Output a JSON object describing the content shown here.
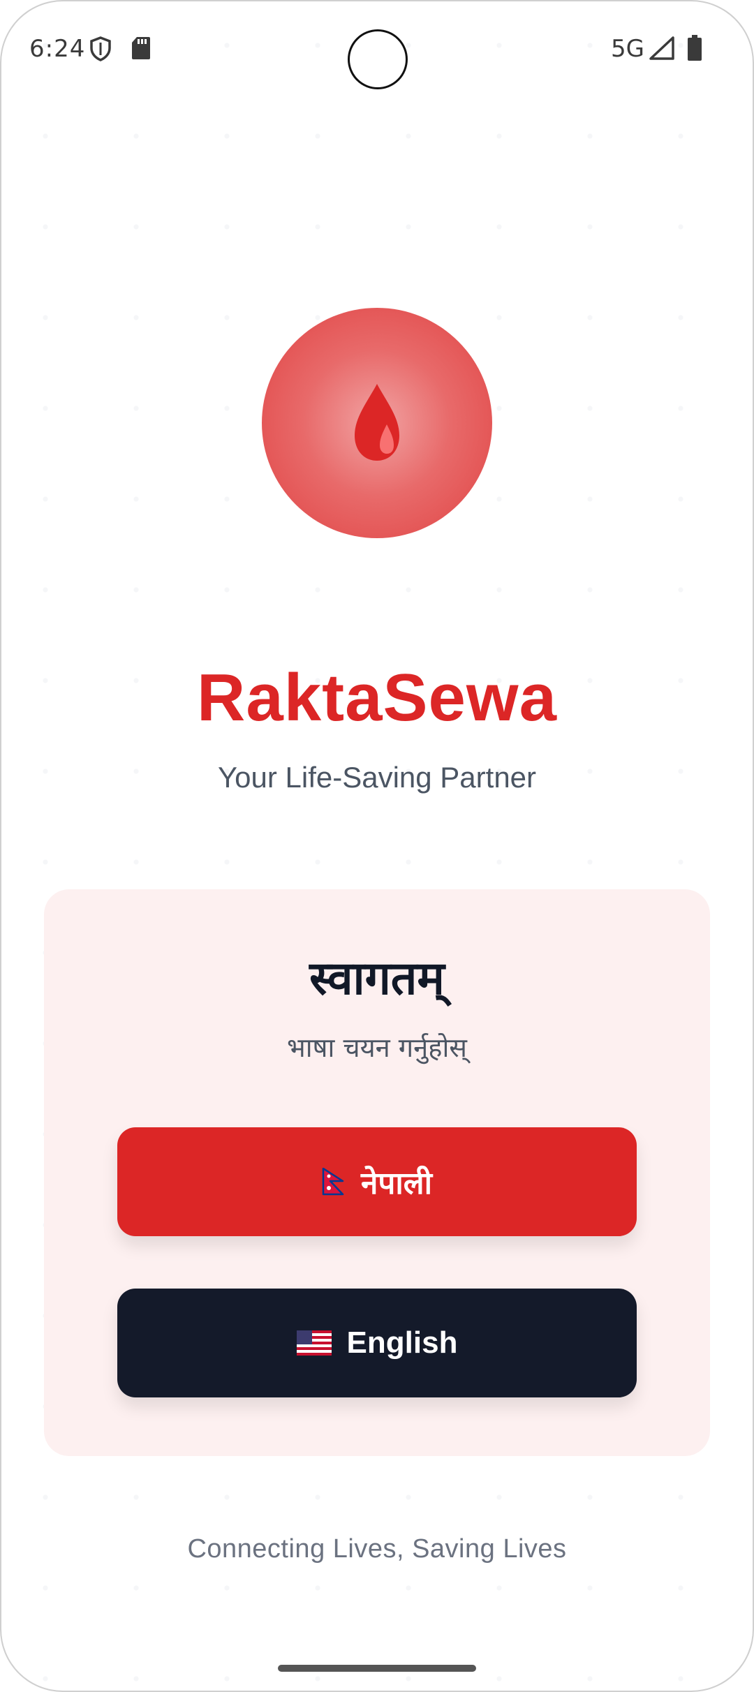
{
  "status_bar": {
    "time": "6:24",
    "network": "5G",
    "icons": [
      "shield-icon",
      "sd-card-icon",
      "signal-icon",
      "battery-icon"
    ]
  },
  "app": {
    "logo_icon": "blood-drop-icon",
    "title": "RaktaSewa",
    "tagline": "Your Life-Saving Partner"
  },
  "language_card": {
    "welcome": "स्वागतम्",
    "prompt": "भाषा चयन गर्नुहोस्",
    "buttons": [
      {
        "label": "नेपाली",
        "flag": "nepal-flag-icon",
        "color": "#dc2626"
      },
      {
        "label": "English",
        "flag": "us-flag-icon",
        "color": "#141a2a"
      }
    ]
  },
  "footer": {
    "text": "Connecting Lives, Saving Lives"
  },
  "colors": {
    "brand_red": "#dc2626",
    "dark": "#141a2a",
    "card_bg": "#fdf0f0"
  }
}
